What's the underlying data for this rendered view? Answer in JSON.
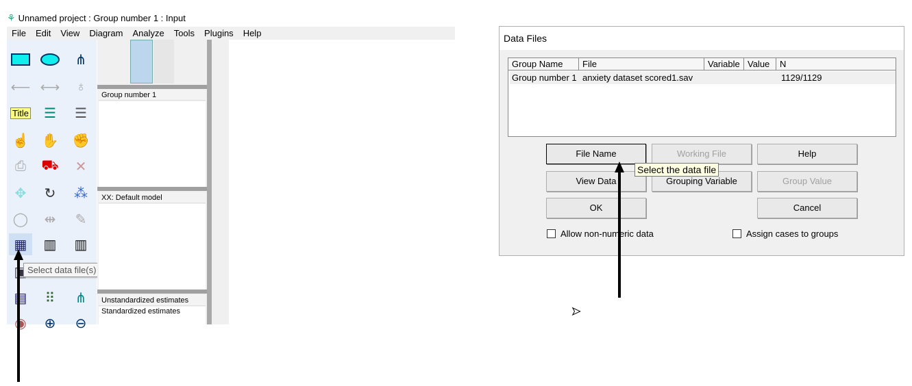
{
  "window": {
    "title": "Unnamed project : Group number 1 : Input",
    "icon": "amos-app-icon"
  },
  "menu": [
    "File",
    "Edit",
    "View",
    "Diagram",
    "Analyze",
    "Tools",
    "Plugins",
    "Help"
  ],
  "toolbox": {
    "tooltip": "Select data file(s)",
    "selected_tool": "select-data-files-icon"
  },
  "panel": {
    "groups_header": "Group number 1",
    "models_header": "XX: Default model",
    "estimates": [
      "Unstandardized estimates",
      "Standardized estimates"
    ]
  },
  "dialog": {
    "title": "Data Files",
    "columns": [
      "Group Name",
      "File",
      "Variable",
      "Value",
      "N"
    ],
    "rows": [
      {
        "group": "Group number 1",
        "file": "anxiety dataset scored1.sav",
        "variable": "",
        "value": "",
        "n": "1129/1129"
      }
    ],
    "buttons": {
      "file_name": "File Name",
      "working_file": "Working File",
      "help": "Help",
      "view_data": "View Data",
      "grouping_variable": "Grouping Variable",
      "group_value": "Group Value",
      "ok": "OK",
      "cancel": "Cancel"
    },
    "checkboxes": {
      "allow_non_numeric": "Allow non-numeric data",
      "assign_cases": "Assign cases to groups"
    },
    "tooltip": "Select the data file"
  }
}
